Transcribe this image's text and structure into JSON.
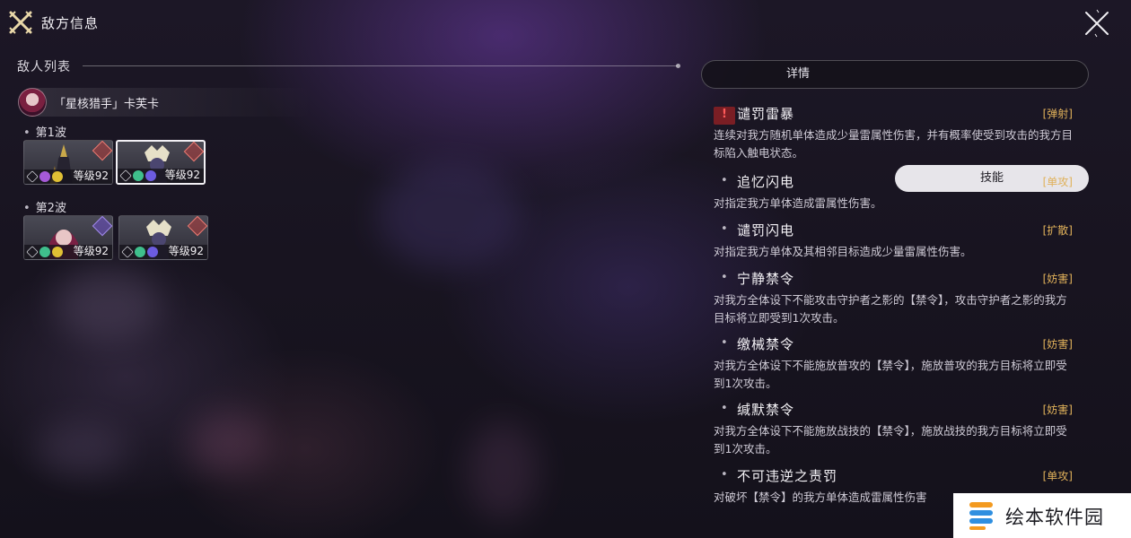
{
  "header": {
    "title": "敌方信息",
    "title_icon": "crossed-swords-icon",
    "close_icon": "close-icon"
  },
  "enemy_list": {
    "heading": "敌人列表",
    "boss": {
      "name": "「星核猎手」卡芙卡"
    },
    "waves": [
      {
        "label": "第1波",
        "enemies": [
          {
            "level": "等级92",
            "selected": false
          },
          {
            "level": "等级92",
            "selected": true
          }
        ]
      },
      {
        "label": "第2波",
        "enemies": [
          {
            "level": "等级92",
            "selected": false
          },
          {
            "level": "等级92",
            "selected": false
          }
        ]
      }
    ]
  },
  "tabs": [
    {
      "label": "详情",
      "active": false
    },
    {
      "label": "技能",
      "active": true
    }
  ],
  "skills": [
    {
      "name": "谴罚雷暴",
      "tag": "[弹射]",
      "desc": "连续对我方随机单体造成少量雷属性伤害，并有概率使受到攻击的我方目标陷入触电状态。",
      "warning": true
    },
    {
      "name": "追忆闪电",
      "tag": "[单攻]",
      "desc": "对指定我方单体造成雷属性伤害。",
      "warning": false
    },
    {
      "name": "谴罚闪电",
      "tag": "[扩散]",
      "desc": "对指定我方单体及其相邻目标造成少量雷属性伤害。",
      "warning": false
    },
    {
      "name": "宁静禁令",
      "tag": "[妨害]",
      "desc": "对我方全体设下不能攻击守护者之影的【禁令】，攻击守护者之影的我方目标将立即受到1次攻击。",
      "warning": false
    },
    {
      "name": "缴械禁令",
      "tag": "[妨害]",
      "desc": "对我方全体设下不能施放普攻的【禁令】，施放普攻的我方目标将立即受到1次攻击。",
      "warning": false
    },
    {
      "name": "缄默禁令",
      "tag": "[妨害]",
      "desc": "对我方全体设下不能施放战技的【禁令】，施放战技的我方目标将立即受到1次攻击。",
      "warning": false
    },
    {
      "name": "不可违逆之责罚",
      "tag": "[单攻]",
      "desc": "对破坏【禁令】的我方单体造成雷属性伤害",
      "warning": false
    }
  ],
  "watermark": {
    "text": "绘本软件园"
  },
  "colors": {
    "tag": "#e0b15a",
    "warning": "#ff5a5a",
    "active_tab": "#e7e5ea"
  }
}
